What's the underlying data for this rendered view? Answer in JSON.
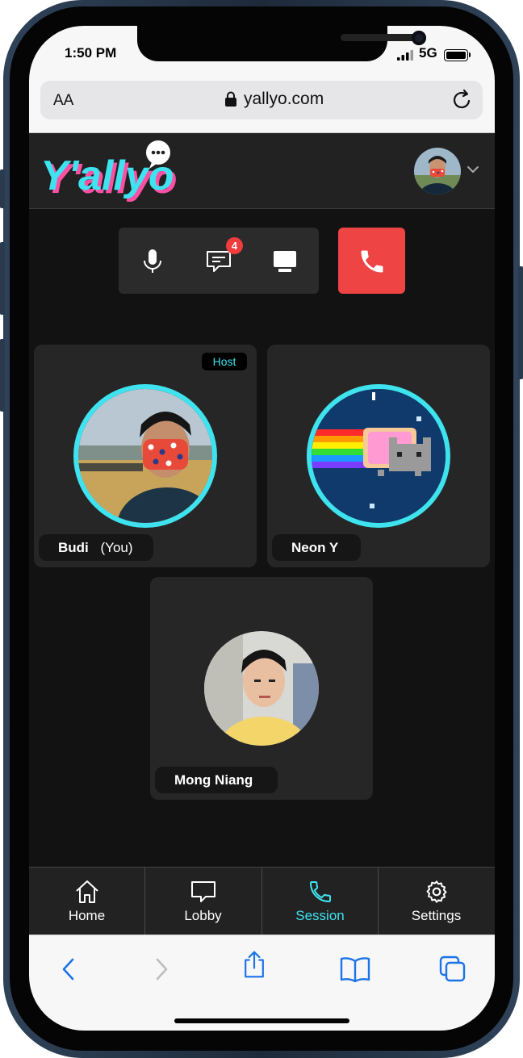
{
  "status_bar": {
    "time": "1:50 PM",
    "network": "5G"
  },
  "browser": {
    "text_size_label": "AA",
    "url": "yallyo.com"
  },
  "app": {
    "logo_text": "Y'allyo",
    "brand_color": "#3fe3ef",
    "accent_pink": "#ff4fa3"
  },
  "controls": {
    "mic_icon": "microphone-icon",
    "chat_icon": "chat-icon",
    "chat_unread": "4",
    "screen_icon": "monitor-icon",
    "end_call_icon": "phone-hangup-icon",
    "end_call_color": "#ef4444"
  },
  "participants": [
    {
      "name": "Budi",
      "suffix": "(You)",
      "badge": "Host"
    },
    {
      "name": "Neon Y",
      "suffix": ""
    },
    {
      "name": "Mong Niang",
      "suffix": ""
    }
  ],
  "bottom_nav": [
    {
      "label": "Home",
      "icon": "home-icon",
      "active": false
    },
    {
      "label": "Lobby",
      "icon": "chat-bubble-icon",
      "active": false
    },
    {
      "label": "Session",
      "icon": "phone-icon",
      "active": true
    },
    {
      "label": "Settings",
      "icon": "gear-icon",
      "active": false
    }
  ],
  "safari_toolbar": [
    "back-icon",
    "forward-icon",
    "share-icon",
    "bookmarks-icon",
    "tabs-icon"
  ]
}
